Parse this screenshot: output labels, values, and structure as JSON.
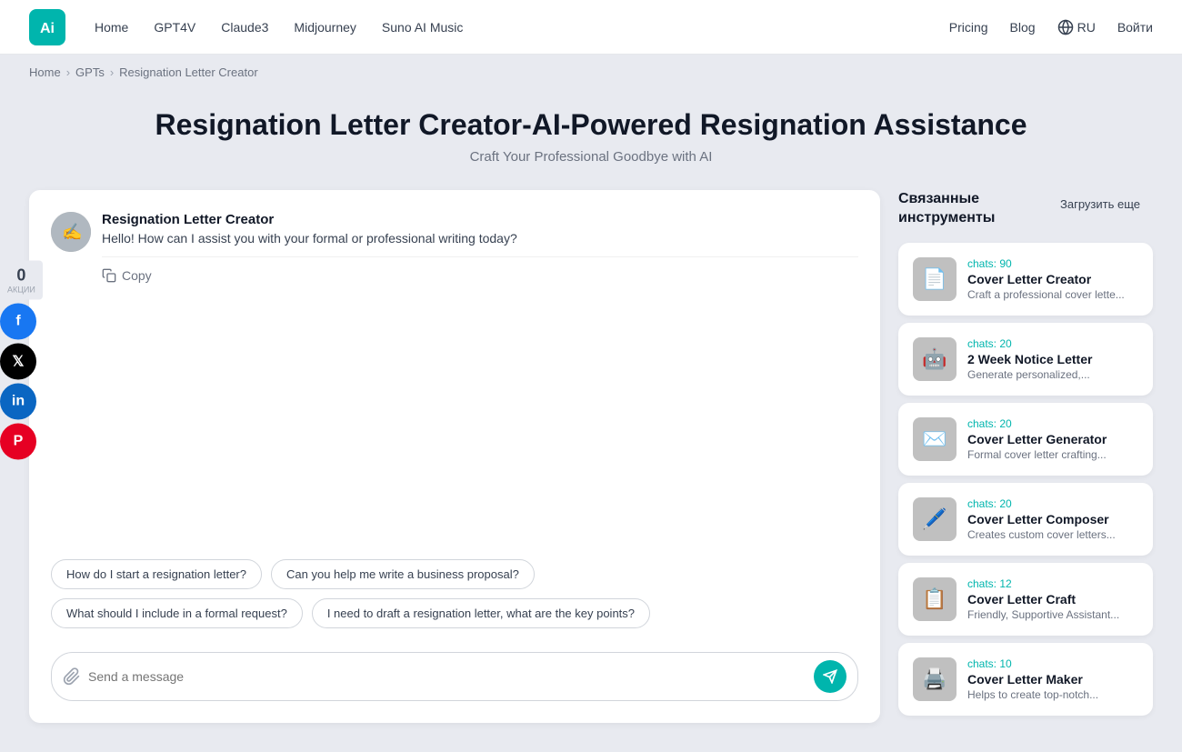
{
  "header": {
    "logo_text": "Ai",
    "nav_items": [
      "Home",
      "GPT4V",
      "Claude3",
      "Midjourney",
      "Suno AI Music"
    ],
    "right_items": [
      "Pricing",
      "Blog"
    ],
    "lang": "RU",
    "login": "Войти"
  },
  "breadcrumb": {
    "items": [
      "Home",
      "GPTs",
      "Resignation Letter Creator"
    ],
    "separators": [
      ">",
      ">"
    ]
  },
  "page": {
    "title": "Resignation Letter Creator-AI-Powered Resignation Assistance",
    "subtitle": "Craft Your Professional Goodbye with AI"
  },
  "chat": {
    "bot_name": "Resignation Letter Creator",
    "bot_greeting": "Hello! How can I assist you with your formal or professional writing today?",
    "copy_label": "Copy",
    "input_placeholder": "Send a message",
    "suggestions": [
      "How do I start a resignation letter?",
      "Can you help me write a business proposal?",
      "What should I include in a formal request?",
      "I need to draft a resignation letter, what are the key points?"
    ]
  },
  "sidebar": {
    "title": "Связанные инструменты",
    "load_more": "Загрузить еще",
    "related": [
      {
        "name": "Cover Letter Creator",
        "desc": "Craft a professional cover lette...",
        "chats": "chats: 90",
        "emoji": "📄"
      },
      {
        "name": "2 Week Notice Letter",
        "desc": "Generate personalized,...",
        "chats": "chats: 20",
        "emoji": "🤖"
      },
      {
        "name": "Cover Letter Generator",
        "desc": "Formal cover letter crafting...",
        "chats": "chats: 20",
        "emoji": "✉️"
      },
      {
        "name": "Cover Letter Composer",
        "desc": "Creates custom cover letters...",
        "chats": "chats: 20",
        "emoji": "🖊️"
      },
      {
        "name": "Cover Letter Craft",
        "desc": "Friendly, Supportive Assistant...",
        "chats": "chats: 12",
        "emoji": "📋"
      },
      {
        "name": "Cover Letter Maker",
        "desc": "Helps to create top-notch...",
        "chats": "chats: 10",
        "emoji": "🖨️"
      }
    ]
  },
  "social": {
    "count": "0",
    "label": "АКЦИИ",
    "buttons": [
      "f",
      "X",
      "in",
      "P"
    ]
  }
}
